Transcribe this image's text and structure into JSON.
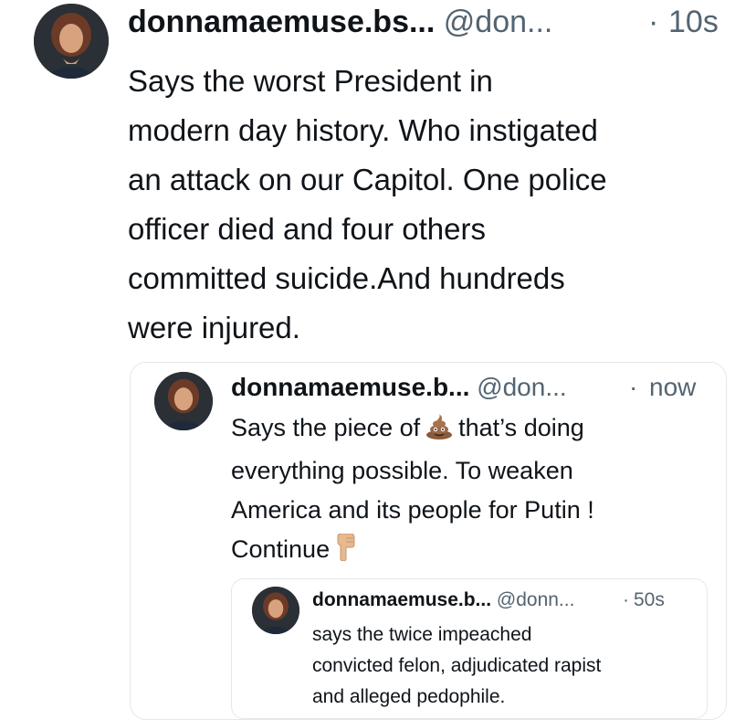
{
  "main_tweet": {
    "display_name": "donnamaemuse.bs...",
    "handle": "@don...",
    "separator": "·",
    "time": "10s",
    "text_lines": [
      "Says the worst President in",
      "modern day history. Who instigated",
      "an attack on our Capitol. One police",
      "officer died and four others",
      "committed suicide.And hundreds",
      "were injured."
    ]
  },
  "quoted_tweet": {
    "display_name": "donnamaemuse.b...",
    "handle": "@don...",
    "separator": "·",
    "time": "now",
    "text_line1_before": "Says the piece of",
    "emoji1": "pile-of-poo-emoji",
    "text_line1_after": "that’s doing",
    "text_lines": [
      "everything possible. To weaken",
      "America and its people for Putin !"
    ],
    "last_line_text": "Continue",
    "emoji2": "backhand-index-pointing-down-emoji"
  },
  "nested_quoted_tweet": {
    "display_name": "donnamaemuse.b...",
    "handle": "@donn...",
    "separator": "·",
    "time": "50s",
    "text_lines": [
      "says the twice impeached",
      "convicted felon, adjudicated rapist",
      "and alleged pedophile."
    ]
  },
  "colors": {
    "text": "#0f1419",
    "secondary_text": "#536471",
    "card_border": "#e4e8eb",
    "background": "#ffffff"
  }
}
